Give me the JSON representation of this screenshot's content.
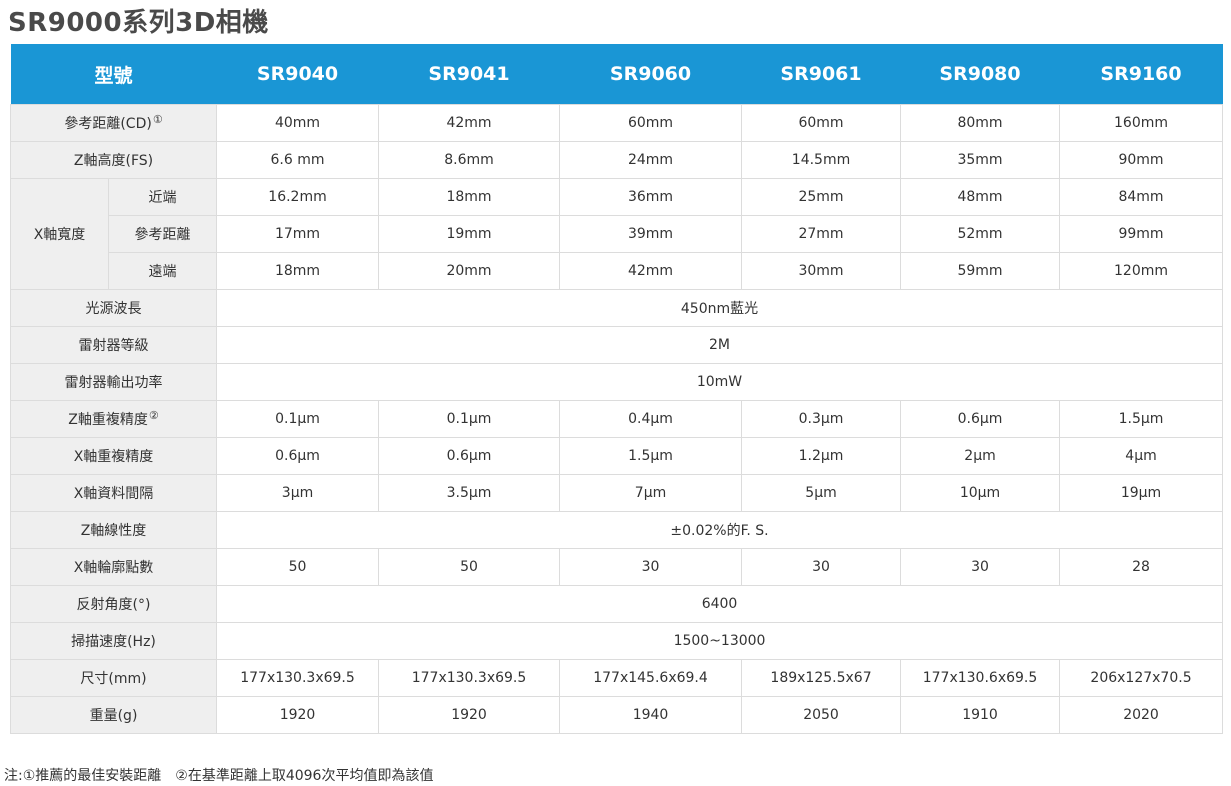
{
  "title": "SR9000系列3D相機",
  "header": {
    "label": "型號",
    "models": [
      "SR9040",
      "SR9041",
      "SR9060",
      "SR9061",
      "SR9080",
      "SR9160"
    ]
  },
  "rows": {
    "cd": {
      "label": "參考距離(CD)",
      "sup": "①",
      "values": [
        "40mm",
        "42mm",
        "60mm",
        "60mm",
        "80mm",
        "160mm"
      ]
    },
    "fs": {
      "label": "Z軸高度(FS)",
      "values": [
        "6.6 mm",
        "8.6mm",
        "24mm",
        "14.5mm",
        "35mm",
        "90mm"
      ]
    },
    "xw": {
      "label": "X軸寬度",
      "near": {
        "label": "近端",
        "values": [
          "16.2mm",
          "18mm",
          "36mm",
          "25mm",
          "48mm",
          "84mm"
        ]
      },
      "ref": {
        "label": "參考距離",
        "values": [
          "17mm",
          "19mm",
          "39mm",
          "27mm",
          "52mm",
          "99mm"
        ]
      },
      "far": {
        "label": "遠端",
        "values": [
          "18mm",
          "20mm",
          "42mm",
          "30mm",
          "59mm",
          "120mm"
        ]
      }
    },
    "wavelength": {
      "label": "光源波長",
      "value": "450nm藍光"
    },
    "laser_class": {
      "label": "雷射器等級",
      "value": "2M"
    },
    "laser_power": {
      "label": "雷射器輸出功率",
      "value": "10mW"
    },
    "z_rep": {
      "label": "Z軸重複精度",
      "sup": "②",
      "values": [
        "0.1μm",
        "0.1μm",
        "0.4μm",
        "0.3μm",
        "0.6μm",
        "1.5μm"
      ]
    },
    "x_rep": {
      "label": "X軸重複精度",
      "values": [
        "0.6μm",
        "0.6μm",
        "1.5μm",
        "1.2μm",
        "2μm",
        "4μm"
      ]
    },
    "x_int": {
      "label": "X軸資料間隔",
      "values": [
        "3μm",
        "3.5μm",
        "7μm",
        "5μm",
        "10μm",
        "19μm"
      ]
    },
    "z_lin": {
      "label": "Z軸線性度",
      "value": "±0.02%的F. S."
    },
    "x_pts": {
      "label": "X軸輪廓點數",
      "values": [
        "50",
        "50",
        "30",
        "30",
        "30",
        "28"
      ]
    },
    "angle": {
      "label": "反射角度(°)",
      "value": "6400"
    },
    "scan": {
      "label": "掃描速度(Hz)",
      "value": "1500~13000"
    },
    "size": {
      "label": "尺寸(mm)",
      "values": [
        "177x130.3x69.5",
        "177x130.3x69.5",
        "177x145.6x69.4",
        "189x125.5x67",
        "177x130.6x69.5",
        "206x127x70.5"
      ]
    },
    "weight": {
      "label": "重量(g)",
      "values": [
        "1920",
        "1920",
        "1940",
        "2050",
        "1910",
        "2020"
      ]
    }
  },
  "footnote": "注:①推薦的最佳安裝距離　②在基準距離上取4096次平均值即為該值"
}
